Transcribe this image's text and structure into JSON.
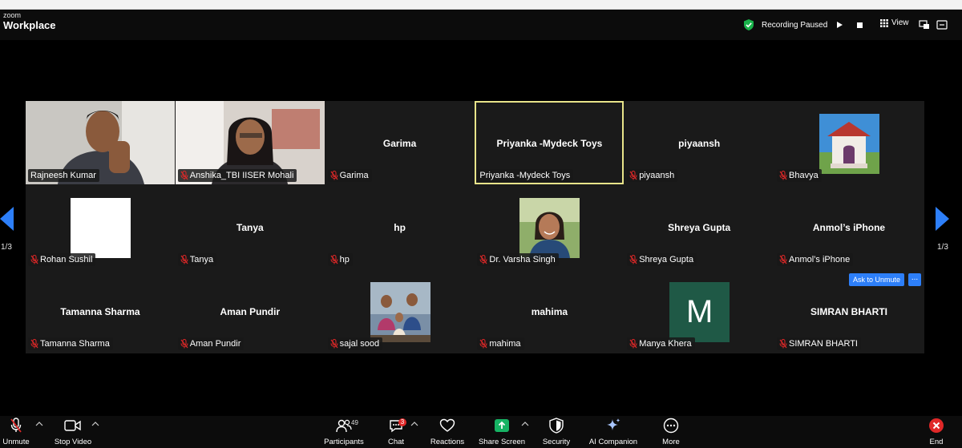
{
  "app": {
    "logo_top": "zoom",
    "logo_bottom": "Workplace",
    "recording_status": "Recording Paused",
    "view_label": "View"
  },
  "pagination": {
    "left": "1/3",
    "right": "1/3"
  },
  "tiles": [
    {
      "name": "Rajneesh Kumar",
      "label": "Rajneesh Kumar",
      "big": "",
      "muted": false,
      "video": "man"
    },
    {
      "name": "Anshika_TBI IISER Mohali",
      "label": "Anshika_TBI IISER Mohali",
      "big": "",
      "muted": true,
      "video": "woman"
    },
    {
      "name": "Garima",
      "label": "Garima",
      "big": "Garima",
      "muted": true
    },
    {
      "name": "Priyanka -Mydeck Toys",
      "label": "Priyanka -Mydeck Toys",
      "big": "Priyanka -Mydeck Toys",
      "muted": false,
      "active": true
    },
    {
      "name": "piyaansh",
      "label": "piyaansh",
      "big": "piyaansh",
      "muted": true
    },
    {
      "name": "Bhavya",
      "label": "Bhavya",
      "big": "",
      "muted": true,
      "avatar": "temple"
    },
    {
      "name": "Rohan Sushil",
      "label": "Rohan Sushil",
      "big": "",
      "muted": true,
      "avatar": "white"
    },
    {
      "name": "Tanya",
      "label": "Tanya",
      "big": "Tanya",
      "muted": true
    },
    {
      "name": "hp",
      "label": "hp",
      "big": "hp",
      "muted": true
    },
    {
      "name": "Dr. Varsha Singh",
      "label": "Dr. Varsha Singh",
      "big": "",
      "muted": true,
      "avatar": "portrait"
    },
    {
      "name": "Shreya Gupta",
      "label": "Shreya Gupta",
      "big": "Shreya Gupta",
      "muted": true
    },
    {
      "name": "Anmol's iPhone",
      "label": "Anmol’s iPhone",
      "big": "Anmol’s iPhone",
      "muted": true
    },
    {
      "name": "Tamanna Sharma",
      "label": "Tamanna Sharma",
      "big": "Tamanna Sharma",
      "muted": true
    },
    {
      "name": "Aman Pundir",
      "label": "Aman Pundir",
      "big": "Aman Pundir",
      "muted": true
    },
    {
      "name": "sajal sood",
      "label": "sajal sood",
      "big": "",
      "muted": true,
      "avatar": "family"
    },
    {
      "name": "mahima",
      "label": "mahima",
      "big": "mahima",
      "muted": true
    },
    {
      "name": "Manya Khera",
      "label": "Manya Khera",
      "big": "",
      "muted": true,
      "avatar": "letter",
      "letter": "M"
    },
    {
      "name": "SIMRAN BHARTI",
      "label": "SIMRAN BHARTI",
      "big": "SIMRAN BHARTI",
      "muted": true
    }
  ],
  "ask_to_unmute": "Ask to Unmute",
  "ask_more": "...",
  "toolbar": {
    "unmute": "Unmute",
    "stop_video": "Stop Video",
    "participants": "Participants",
    "participants_count": "49",
    "chat": "Chat",
    "chat_badge": "3",
    "reactions": "Reactions",
    "share_screen": "Share Screen",
    "security": "Security",
    "ai_companion": "AI Companion",
    "more": "More",
    "end": "End"
  },
  "colors": {
    "accent_blue": "#2d7ff9",
    "share_green": "#16b364",
    "mute_red": "#e02828",
    "active_border": "#e8e48a",
    "tile_bg": "#1a1a1a",
    "avatar_teal": "#1f5946"
  }
}
